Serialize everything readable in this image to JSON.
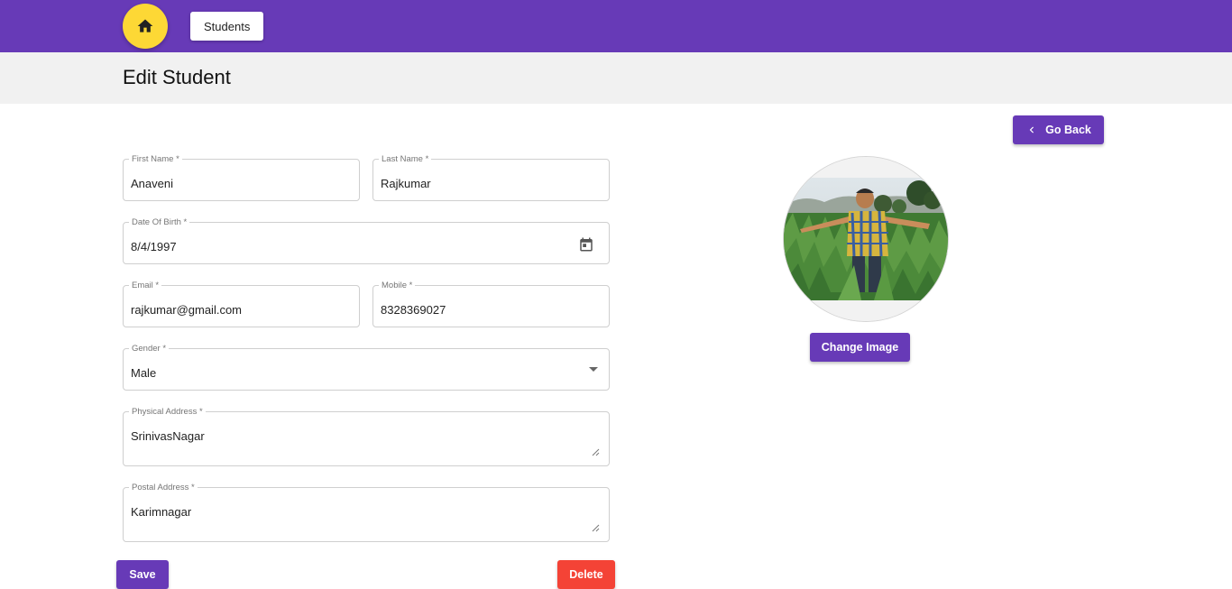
{
  "nav": {
    "home_icon": "home-icon",
    "students_label": "Students"
  },
  "page": {
    "title": "Edit Student"
  },
  "actions": {
    "go_back_label": "Go Back",
    "change_image_label": "Change Image",
    "save_label": "Save",
    "delete_label": "Delete"
  },
  "form": {
    "first_name": {
      "label": "First Name *",
      "value": "Anaveni"
    },
    "last_name": {
      "label": "Last Name *",
      "value": "Rajkumar"
    },
    "dob": {
      "label": "Date Of Birth *",
      "value": "8/4/1997"
    },
    "email": {
      "label": "Email *",
      "value": "rajkumar@gmail.com"
    },
    "mobile": {
      "label": "Mobile *",
      "value": "8328369027"
    },
    "gender": {
      "label": "Gender *",
      "value": "Male"
    },
    "physical_address": {
      "label": "Physical Address *",
      "value": "SrinivasNagar"
    },
    "postal_address": {
      "label": "Postal Address *",
      "value": "Karimnagar"
    }
  },
  "colors": {
    "primary": "#673ab7",
    "accent": "#fdd835",
    "danger": "#f44336",
    "header_bg": "#f1f1f1"
  }
}
